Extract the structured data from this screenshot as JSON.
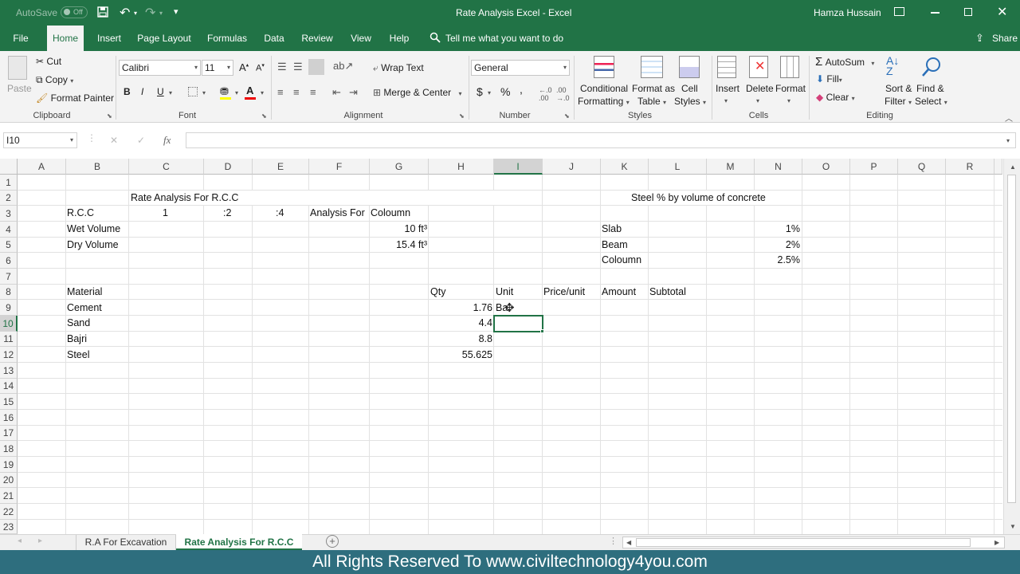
{
  "titlebar": {
    "autosave": "AutoSave",
    "autosave_state": "Off",
    "title": "Rate Analysis Excel  -  Excel",
    "user": "Hamza Hussain"
  },
  "tabs": [
    {
      "label": "File"
    },
    {
      "label": "Home"
    },
    {
      "label": "Insert"
    },
    {
      "label": "Page Layout"
    },
    {
      "label": "Formulas"
    },
    {
      "label": "Data"
    },
    {
      "label": "Review"
    },
    {
      "label": "View"
    },
    {
      "label": "Help"
    }
  ],
  "tell_me": "Tell me what you want to do",
  "share": "Share",
  "ribbon": {
    "clipboard": {
      "paste": "Paste",
      "cut": "Cut",
      "copy": "Copy",
      "format_painter": "Format Painter",
      "group": "Clipboard"
    },
    "font": {
      "name": "Calibri",
      "size": "11",
      "bold": "B",
      "italic": "I",
      "underline": "U",
      "group": "Font"
    },
    "alignment": {
      "wrap": "Wrap Text",
      "merge": "Merge & Center",
      "group": "Alignment"
    },
    "number": {
      "format": "General",
      "currency": "$",
      "percent": "%",
      "comma": ",",
      "group": "Number"
    },
    "styles": {
      "cond1": "Conditional",
      "cond2": "Formatting",
      "fat1": "Format as",
      "fat2": "Table",
      "cs1": "Cell",
      "cs2": "Styles",
      "group": "Styles"
    },
    "cells": {
      "insert": "Insert",
      "delete": "Delete",
      "format": "Format",
      "group": "Cells"
    },
    "editing": {
      "autosum": "AutoSum",
      "fill": "Fill",
      "clear": "Clear",
      "sort1": "Sort &",
      "sort2": "Filter",
      "find1": "Find &",
      "find2": "Select",
      "group": "Editing"
    }
  },
  "formula_bar": {
    "name_box": "I10",
    "cancel": "✕",
    "enter": "✓",
    "fx": "fx",
    "value": ""
  },
  "columns": [
    "A",
    "B",
    "C",
    "D",
    "E",
    "F",
    "G",
    "H",
    "I",
    "J",
    "K",
    "L",
    "M",
    "N",
    "O",
    "P",
    "Q",
    "R"
  ],
  "rows": [
    "1",
    "2",
    "3",
    "4",
    "5",
    "6",
    "7",
    "8",
    "9",
    "10",
    "11",
    "12",
    "13",
    "14",
    "15",
    "16",
    "17",
    "18",
    "19",
    "20",
    "21",
    "22",
    "23"
  ],
  "cells": {
    "title": "Rate Analysis For R.C.C",
    "rcc": "R.C.C",
    "r1": "1",
    "r2": ":2",
    "r3": ":4",
    "analysis_for": "Analysis For",
    "analysis_val": "Coloumn",
    "wet": "Wet Volume",
    "wet_val": "10 ft³",
    "dry": "Dry Volume",
    "dry_val": "15.4 ft³",
    "steel_title": "Steel % by volume of concrete",
    "slab": "Slab",
    "slab_val": "1%",
    "beam": "Beam",
    "beam_val": "2%",
    "col": "Coloumn",
    "col_val": "2.5%",
    "h_material": "Material",
    "h_qty": "Qty",
    "h_unit": "Unit",
    "h_price": "Price/unit",
    "h_amount": "Amount",
    "h_subtotal": "Subtotal",
    "m1": "Cement",
    "q1": "1.76",
    "u1": "Ba",
    "m2": "Sand",
    "q2": "4.4",
    "m3": "Bajri",
    "q3": "8.8",
    "m4": "Steel",
    "q4": "55.625"
  },
  "sheets": [
    {
      "label": "R.A For Excavation"
    },
    {
      "label": "Rate Analysis For R.C.C"
    }
  ],
  "footer": "All Rights Reserved To www.civiltechnology4you.com",
  "colors": {
    "excel_green": "#217346",
    "footer": "#2e6e7e"
  }
}
